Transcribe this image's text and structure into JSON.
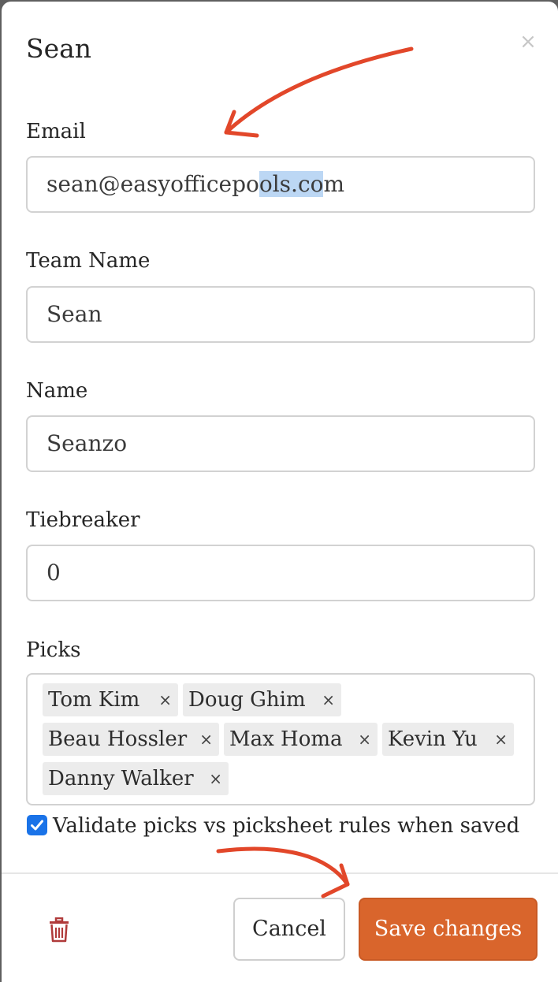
{
  "modal": {
    "title": "Sean",
    "close_label": "×"
  },
  "form": {
    "email": {
      "label": "Email",
      "value_before": "sean@easyofficepo",
      "value_selected": "ols.co",
      "value_after": "m"
    },
    "team_name": {
      "label": "Team Name",
      "value": "Sean"
    },
    "name": {
      "label": "Name",
      "value": "Seanzo"
    },
    "tiebreaker": {
      "label": "Tiebreaker",
      "value": "0"
    },
    "picks": {
      "label": "Picks",
      "items": [
        {
          "name": "Tom Kim"
        },
        {
          "name": "Doug Ghim"
        },
        {
          "name": "Beau Hossler"
        },
        {
          "name": "Max Homa"
        },
        {
          "name": "Kevin Yu"
        },
        {
          "name": "Danny Walker"
        }
      ],
      "remove_label": "×"
    },
    "validate": {
      "checked": true,
      "label": "Validate picks vs picksheet rules when saved"
    }
  },
  "footer": {
    "delete_icon": "trash-icon",
    "cancel_label": "Cancel",
    "save_label": "Save changes"
  },
  "colors": {
    "accent": "#d9652c",
    "checkbox": "#1a73e8",
    "annotation_arrow": "#e2472a",
    "trash": "#b03a3a",
    "selection": "#bcd7f4"
  }
}
